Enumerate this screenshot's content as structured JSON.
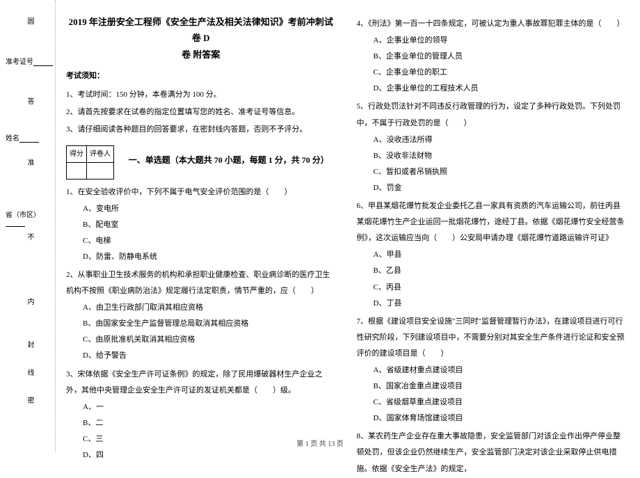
{
  "binding": {
    "v1": "圆",
    "v2": "答",
    "v3": "准",
    "v4": "不",
    "v5": "内",
    "v6": "线",
    "v7": "封",
    "v8": "密",
    "h1": "准考证号",
    "h2": "姓名",
    "h3": "省（市区）"
  },
  "title_line1": "2019 年注册安全工程师《安全生产法及相关法律知识》考前冲刺试卷 D",
  "title_line2": "卷 附答案",
  "notice_head": "考试须知：",
  "instr1": "1、考试时间：150 分钟，本卷满分为 100 分。",
  "instr2": "2、请首先按要求在试卷的指定位置填写您的姓名、准考证号等信息。",
  "instr3": "3、请仔细阅读各种题目的回答要求，在密封线内答题，否则不予评分。",
  "score_cells": {
    "a": "得分",
    "b": "评卷人"
  },
  "part1_title": "一、单选题（本大题共 70 小题，每题 1 分，共 70 分）",
  "q1": {
    "stem": "1、在安全验收评价中，下列不属于电气安全评价范围的是（　　）",
    "a": "A、变电所",
    "b": "B、配电室",
    "c": "C、电梯",
    "d": "D、防雷、防静电系统"
  },
  "q2": {
    "stem": "2、从事职业卫生技术服务的机构和承担职业健康检查、职业病诊断的医疗卫生机构不按照《职业病防治法》规定履行法定职责，情节严重的，应（　　）",
    "a": "A、由卫生行政部门取消其相应资格",
    "b": "B、由国家安全生产监督管理总局取消其相应资格",
    "c": "C、由原批准机关取消其相应资格",
    "d": "D、给予警告"
  },
  "q3": {
    "stem": "3、宋体依据《安全生产许可证条例》的规定，除了民用爆破器材生产企业之外，其他中央管理企业安全生产许可证的发证机关都是（　　）级。",
    "a": "A、一",
    "b": "B、二",
    "c": "C、三",
    "d": "D、四"
  },
  "q4": {
    "stem": "4、《刑法》第一百一十四条规定，可被认定为重人事故罪犯罪主体的是（　　）",
    "a": "A、企事业单位的领导",
    "b": "B、企事业单位的管理人员",
    "c": "C、企事业单位的职工",
    "d": "D、企事业单位的工程技术人员"
  },
  "q5": {
    "stem": "5、行政处罚法针对不同违反行政管理的行为，设定了多种行政处罚。下列处罚中，不属于行政处罚的是（　　）",
    "a": "A、没收违法所得",
    "b": "B、没收非法财物",
    "c": "C、暂扣或者吊销执照",
    "d": "D、罚金"
  },
  "q6": {
    "stem": "6、甲县某烟花爆竹批发企业委托乙县一家具有资质的汽车运输公司，前往丙县某烟花爆竹生产企业运回一批烟花爆竹，途经丁县。依据《烟花爆竹安全经营条例》，这次运输应当向（　　）公安局申请办理《烟花爆竹道路运输许可证》",
    "a": "A、甲县",
    "b": "B、乙县",
    "c": "C、丙县",
    "d": "D、丁县"
  },
  "q7": {
    "stem": "7、根据《建设项目安全设施\"三同时\"监督管理暂行办法》，在建设项目进行可行性研究阶段，下列建设项目中，不需要分别对其安全生产条件进行论证和安全预评价的建设项目是（　　）",
    "a": "A、省级建材重点建设项目",
    "b": "B、国家冶金重点建设项目",
    "c": "C、省级烟草重点建设项目",
    "d": "D、国家体育场馆建设项目"
  },
  "q8": {
    "stem": "8、某农药生产企业存在重大事故隐患，安全监管部门对该企业作出停产停业整顿处罚，但该企业仍然继续生产，安全监管部门决定对该企业采取停止供电措施。依据《安全生产法》的规定，"
  },
  "footer": "第 1 页 共 13 页"
}
